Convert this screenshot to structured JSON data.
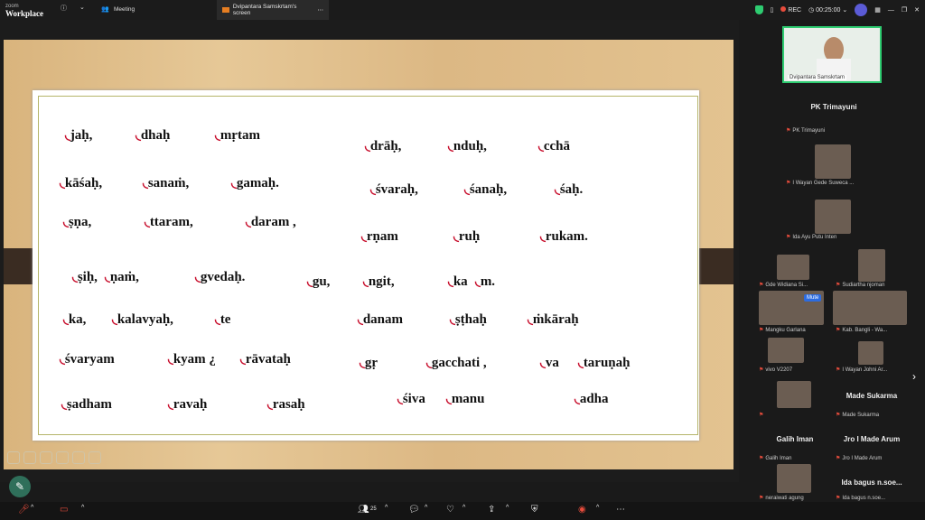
{
  "app": {
    "brand_small": "zoom",
    "brand_big": "Workplace",
    "meeting_tab": "Meeting",
    "share_tab": "Dvipantara Samskrtam's screen",
    "rec": "REC",
    "timer": "00:25:00"
  },
  "lesson": {
    "col1": [
      [
        "jaḥ,",
        "dhaḥ",
        "mṛtam"
      ],
      [
        "kāśaḥ,",
        "sanaṁ,",
        "gamaḥ."
      ],
      [
        "ṣṇa,",
        "ttaram,",
        "daram ,"
      ],
      [
        "ṣiḥ,",
        "ṇaṁ,",
        "gvedaḥ."
      ],
      [
        "ka,",
        "kalavyaḥ,",
        "te"
      ],
      [
        "śvaryam",
        "kyam ¿",
        "rāvataḥ"
      ],
      [
        "ṣadham",
        "ravaḥ",
        "rasaḥ"
      ]
    ],
    "col2": [
      [
        "drāḥ,",
        "nduḥ,",
        "cchā"
      ],
      [
        "śvaraḥ,",
        "śanaḥ,",
        "śaḥ."
      ],
      [
        "rṇam",
        "ruḥ",
        "rukam."
      ],
      [
        "gu,",
        "ngit,",
        "ka",
        "m."
      ],
      [
        "danam",
        "ṣṭhaḥ",
        "ṁkāraḥ"
      ],
      [
        "gṛ",
        "gacchati ,",
        "va",
        "taruṇaḥ"
      ],
      [
        "śiva",
        "manu",
        "adha"
      ]
    ]
  },
  "participants": {
    "host_label": "Dvipantara Samskrtam",
    "tiles": [
      {
        "title": "PK Trimayuni",
        "sub": "PK Trimayuni"
      },
      {
        "title": "",
        "sub": "I Wayan Gede Suweca ..."
      },
      {
        "title": "",
        "sub": "Ida Ayu Putu Inten"
      },
      {
        "title": "",
        "sub": "Gde Widiana Si..."
      },
      {
        "title": "",
        "sub": "Sudiartha njoman"
      },
      {
        "title": "",
        "sub": "Mangku Garlana"
      },
      {
        "title": "",
        "sub": "Kab. Bangli - Wa..."
      },
      {
        "title": "",
        "sub": "vivo V2207"
      },
      {
        "title": "",
        "sub": "I Wayan Johni Ar..."
      },
      {
        "title": "",
        "sub": ""
      },
      {
        "title": "Made Sukarma",
        "sub": "Made Sukarma"
      },
      {
        "title": "Galih Iman",
        "sub": "Galih Iman"
      },
      {
        "title": "Jro I Made Arum",
        "sub": "Jro I Made Arum"
      },
      {
        "title": "",
        "sub": "neraiwati agung"
      },
      {
        "title": "Ida bagus n.soe...",
        "sub": "Ida bagus n.soe..."
      }
    ],
    "mute_badge": "Mute"
  },
  "toolbar": {
    "participants_count": "25"
  }
}
